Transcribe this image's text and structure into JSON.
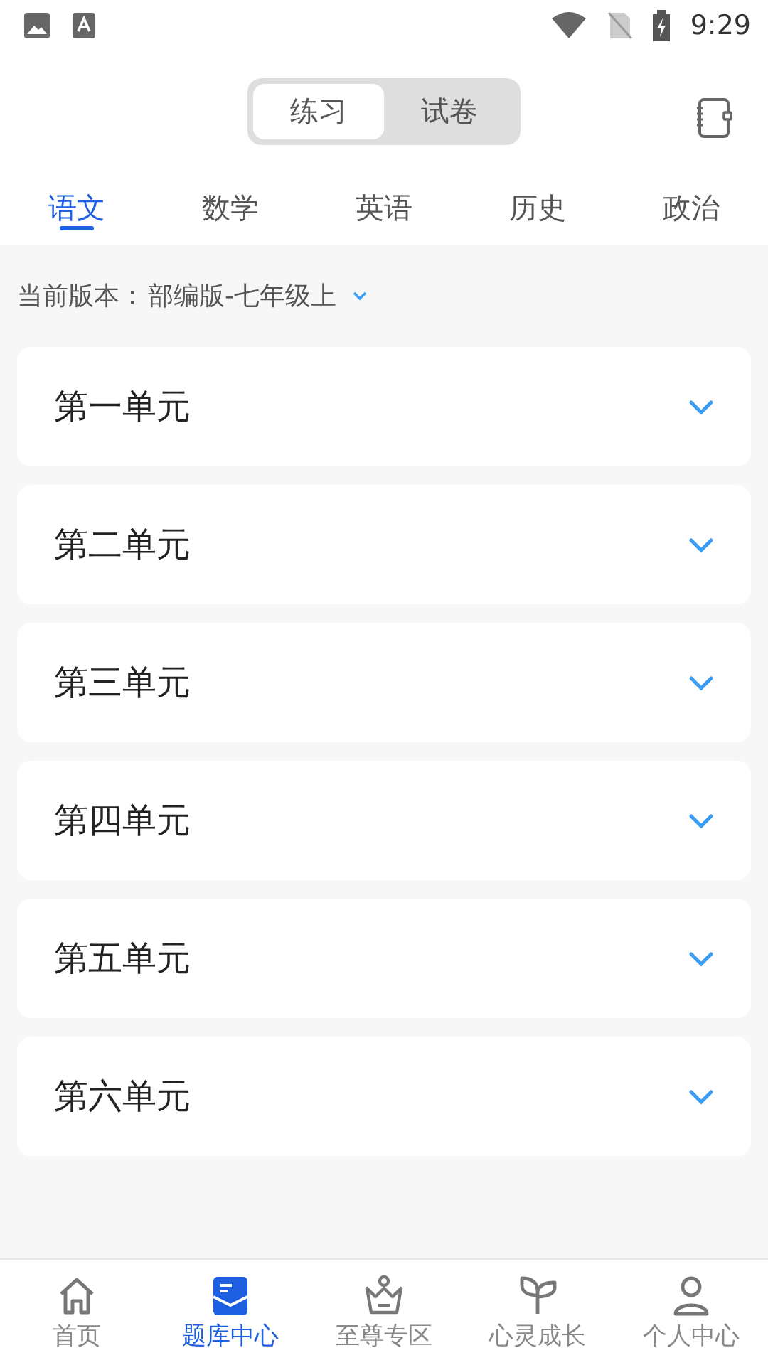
{
  "status_bar": {
    "time": "9:29"
  },
  "mode_switch": [
    {
      "label": "练习",
      "selected": true
    },
    {
      "label": "试卷",
      "selected": false
    }
  ],
  "subject_tabs": [
    {
      "label": "语文",
      "selected": true
    },
    {
      "label": "数学",
      "selected": false
    },
    {
      "label": "英语",
      "selected": false
    },
    {
      "label": "历史",
      "selected": false
    },
    {
      "label": "政治",
      "selected": false
    }
  ],
  "edition": {
    "label": "当前版本：",
    "value": "部编版-七年级上"
  },
  "units": [
    {
      "title": "第一单元",
      "expanded": false
    },
    {
      "title": "第二单元",
      "expanded": false
    },
    {
      "title": "第三单元",
      "expanded": false
    },
    {
      "title": "第四单元",
      "expanded": false
    },
    {
      "title": "第五单元",
      "expanded": false
    },
    {
      "title": "第六单元",
      "expanded": false
    }
  ],
  "bottom_nav": [
    {
      "kind": "home",
      "label": "首页",
      "selected": false
    },
    {
      "kind": "bank",
      "label": "题库中心",
      "selected": true
    },
    {
      "kind": "crown",
      "label": "至尊专区",
      "selected": false
    },
    {
      "kind": "leaf",
      "label": "心灵成长",
      "selected": false
    },
    {
      "kind": "person",
      "label": "个人中心",
      "selected": false
    }
  ]
}
